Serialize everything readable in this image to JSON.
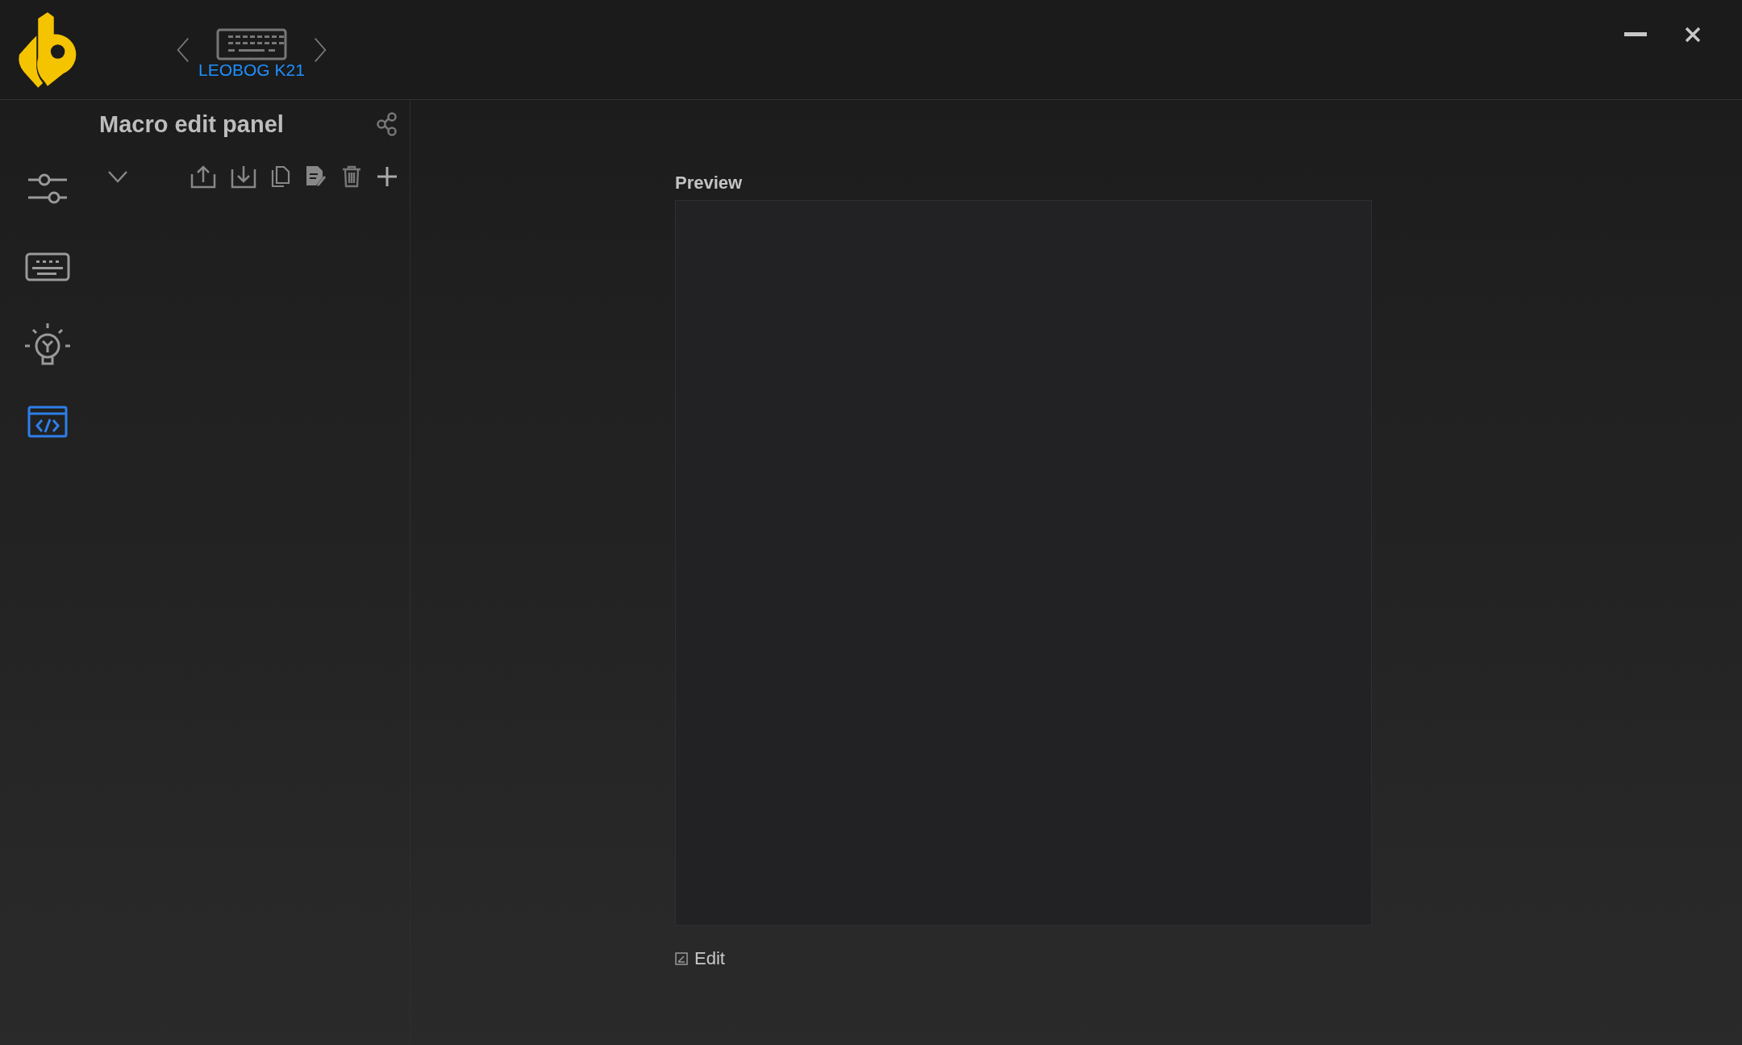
{
  "device": {
    "name": "LEOBOG K21"
  },
  "nav": [
    {
      "kind": "sliders",
      "selected": false
    },
    {
      "kind": "keyboard",
      "selected": false
    },
    {
      "kind": "lighting",
      "selected": false
    },
    {
      "kind": "macro",
      "selected": true
    }
  ],
  "panel": {
    "title": "Macro edit panel"
  },
  "preview": {
    "label": "Preview",
    "edit_label": "Edit"
  }
}
